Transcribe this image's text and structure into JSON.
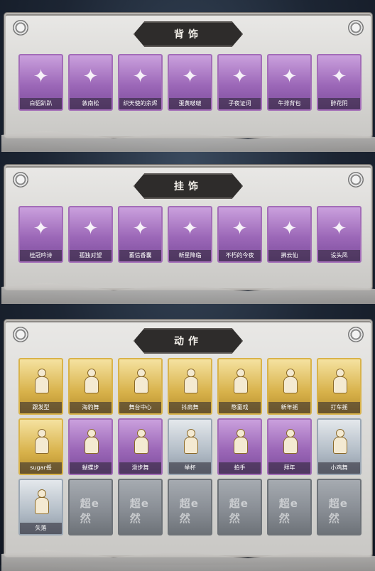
{
  "sections": [
    {
      "title": "背饰",
      "items": [
        {
          "label": "白貂趴趴",
          "icon": "ermine-backpack-icon",
          "rarity": "purple"
        },
        {
          "label": "敦南松",
          "icon": "bonsai-tree-icon",
          "rarity": "purple"
        },
        {
          "label": "织天使的余烬",
          "icon": "angel-doll-icon",
          "rarity": "purple"
        },
        {
          "label": "蛋黄啵啵",
          "icon": "yellow-chick-icon",
          "rarity": "purple"
        },
        {
          "label": "子夜证词",
          "icon": "crow-doll-icon",
          "rarity": "purple"
        },
        {
          "label": "牛排背包",
          "icon": "steak-bag-icon",
          "rarity": "purple"
        },
        {
          "label": "醉花阴",
          "icon": "flower-umbrella-icon",
          "rarity": "purple"
        }
      ]
    },
    {
      "title": "挂饰",
      "items": [
        {
          "label": "桂冠吟诗",
          "icon": "laurel-charm-icon",
          "rarity": "purple"
        },
        {
          "label": "孤独对望",
          "icon": "doll-charm-icon",
          "rarity": "purple"
        },
        {
          "label": "蓄信香囊",
          "icon": "sachet-charm-icon",
          "rarity": "purple"
        },
        {
          "label": "新星降临",
          "icon": "star-charm-icon",
          "rarity": "purple"
        },
        {
          "label": "不朽的今夜",
          "icon": "cat-cake-charm-icon",
          "rarity": "purple"
        },
        {
          "label": "拂云仙",
          "icon": "cloud-fairy-charm-icon",
          "rarity": "purple"
        },
        {
          "label": "设头凤",
          "icon": "phoenix-charm-icon",
          "rarity": "purple"
        }
      ]
    },
    {
      "title": "动作",
      "items": [
        {
          "label": "跟发型",
          "icon": "emote-figure-icon",
          "rarity": "gold"
        },
        {
          "label": "海豹舞",
          "icon": "emote-figure-icon",
          "rarity": "gold"
        },
        {
          "label": "舞台中心",
          "icon": "emote-figure-icon",
          "rarity": "gold"
        },
        {
          "label": "抖肩舞",
          "icon": "emote-figure-icon",
          "rarity": "gold"
        },
        {
          "label": "憋童戏",
          "icon": "emote-figure-icon",
          "rarity": "gold"
        },
        {
          "label": "新年摇",
          "icon": "emote-figure-icon",
          "rarity": "gold"
        },
        {
          "label": "打车摇",
          "icon": "emote-figure-icon",
          "rarity": "gold"
        },
        {
          "label": "sugar摇",
          "icon": "emote-figure-icon",
          "rarity": "gold"
        },
        {
          "label": "蝴蝶步",
          "icon": "emote-figure-icon",
          "rarity": "purple"
        },
        {
          "label": "滑步舞",
          "icon": "emote-figure-icon",
          "rarity": "purple"
        },
        {
          "label": "举杯",
          "icon": "emote-figure-icon",
          "rarity": "silver"
        },
        {
          "label": "拍手",
          "icon": "emote-figure-icon",
          "rarity": "purple"
        },
        {
          "label": "拜年",
          "icon": "emote-figure-icon",
          "rarity": "purple"
        },
        {
          "label": "小鸡舞",
          "icon": "emote-figure-icon",
          "rarity": "silver"
        },
        {
          "label": "失落",
          "icon": "emote-figure-icon",
          "rarity": "silver"
        },
        {
          "label": "",
          "icon": "locked-slot-icon",
          "rarity": "locked"
        },
        {
          "label": "",
          "icon": "locked-slot-icon",
          "rarity": "locked"
        },
        {
          "label": "",
          "icon": "locked-slot-icon",
          "rarity": "locked"
        },
        {
          "label": "",
          "icon": "locked-slot-icon",
          "rarity": "locked"
        },
        {
          "label": "",
          "icon": "locked-slot-icon",
          "rarity": "locked"
        },
        {
          "label": "",
          "icon": "locked-slot-icon",
          "rarity": "locked"
        }
      ]
    }
  ],
  "locked_mark": "超e然",
  "colors": {
    "purple": "#9c68b8",
    "gold": "#d8b24b",
    "silver": "#b2bcc6",
    "locked": "#868b92",
    "banner": "#2e2c2b"
  }
}
